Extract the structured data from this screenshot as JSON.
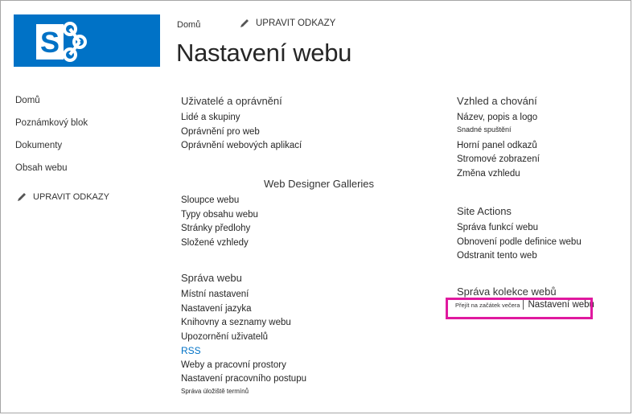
{
  "header": {
    "breadcrumb": "Domů",
    "edit_links": "UPRAVIT ODKAZY",
    "page_title": "Nastavení webu"
  },
  "left_nav": {
    "items": [
      "Domů",
      "Poznámkový blok",
      "Dokumenty",
      "Obsah webu"
    ],
    "edit_links": "UPRAVIT ODKAZY"
  },
  "sections": {
    "users": {
      "title": "Uživatelé a oprávnění",
      "links": [
        "Lidé a skupiny",
        "Oprávnění pro web",
        "Oprávnění webových aplikací"
      ]
    },
    "galleries": {
      "title": "Web Designer Galleries",
      "links": [
        "Sloupce webu",
        "Typy obsahu webu",
        "Stránky předlohy",
        "Složené vzhledy"
      ]
    },
    "admin": {
      "title": "Správa webu",
      "links": [
        "Místní nastavení",
        "Nastavení jazyka",
        "Knihovny a seznamy webu",
        "Upozornění uživatelů",
        "RSS",
        "Weby a pracovní prostory",
        "Nastavení pracovního postupu",
        "Správa úložiště termínů"
      ]
    },
    "look": {
      "title": "Vzhled a chování",
      "links": [
        "Název, popis a logo",
        "Snadné spuštění",
        "Horní panel odkazů",
        "Stromové zobrazení",
        "Změna vzhledu"
      ]
    },
    "actions": {
      "title": "Site Actions",
      "links": [
        "Správa funkcí webu",
        "Obnovení podle definice webu",
        "Odstranit tento web"
      ]
    },
    "collection": {
      "title": "Správa kolekce webů",
      "goto_top": "Přejít na začátek večera",
      "site_settings": "Nastavení webu"
    }
  },
  "colors": {
    "brand": "#0072c6",
    "highlight": "#e0199f"
  }
}
